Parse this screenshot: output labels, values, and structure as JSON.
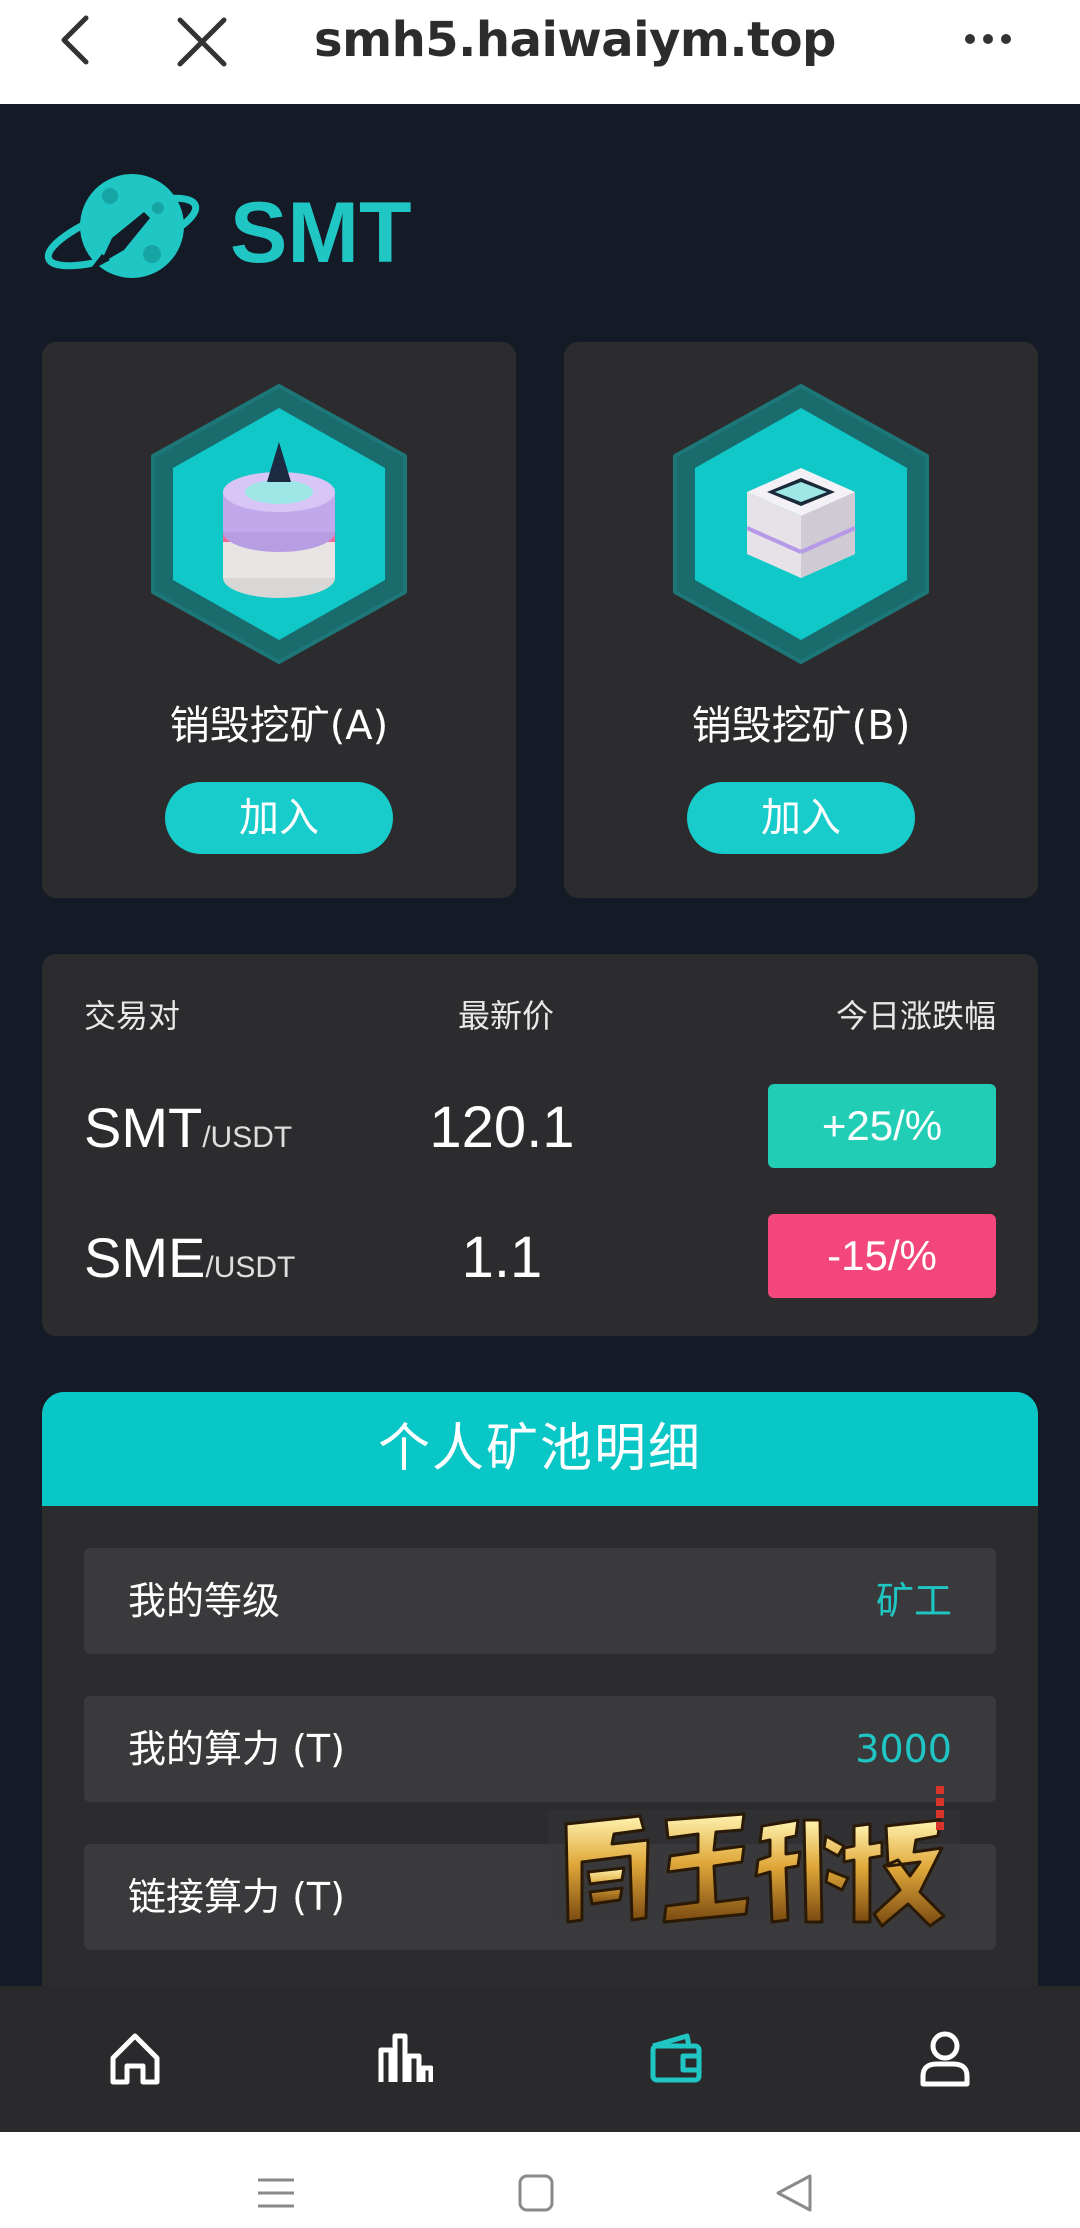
{
  "browser": {
    "url": "smh5.haiwaiym.top"
  },
  "brand": {
    "name": "SMT",
    "accent": "#1fc6c4"
  },
  "mining": [
    {
      "title": "销毁挖矿(A)",
      "button": "加入",
      "icon": "mining-pool-a-icon"
    },
    {
      "title": "销毁挖矿(B)",
      "button": "加入",
      "icon": "mining-pool-b-icon"
    }
  ],
  "market": {
    "headers": {
      "pair": "交易对",
      "price": "最新价",
      "change": "今日涨跌幅"
    },
    "rows": [
      {
        "base": "SMT",
        "quote": "/USDT",
        "price": "120.1",
        "change": "+25/%",
        "direction": "up",
        "color": "#21cdb5"
      },
      {
        "base": "SME",
        "quote": "/USDT",
        "price": "1.1",
        "change": "-15/%",
        "direction": "down",
        "color": "#f2467c"
      }
    ]
  },
  "pool": {
    "title": "个人矿池明细",
    "items": [
      {
        "label": "我的等级",
        "value": "矿工"
      },
      {
        "label": "我的算力 (T)",
        "value": "3000"
      },
      {
        "label": "链接算力 (T)",
        "value": ""
      }
    ]
  },
  "watermark": {
    "text": "南亚科技"
  },
  "nav": {
    "items": [
      {
        "icon": "home-icon",
        "active": false
      },
      {
        "icon": "chart-icon",
        "active": false
      },
      {
        "icon": "wallet-icon",
        "active": true
      },
      {
        "icon": "user-icon",
        "active": false
      }
    ],
    "active_color": "#1fc6c4",
    "inactive_color": "#ffffff"
  }
}
